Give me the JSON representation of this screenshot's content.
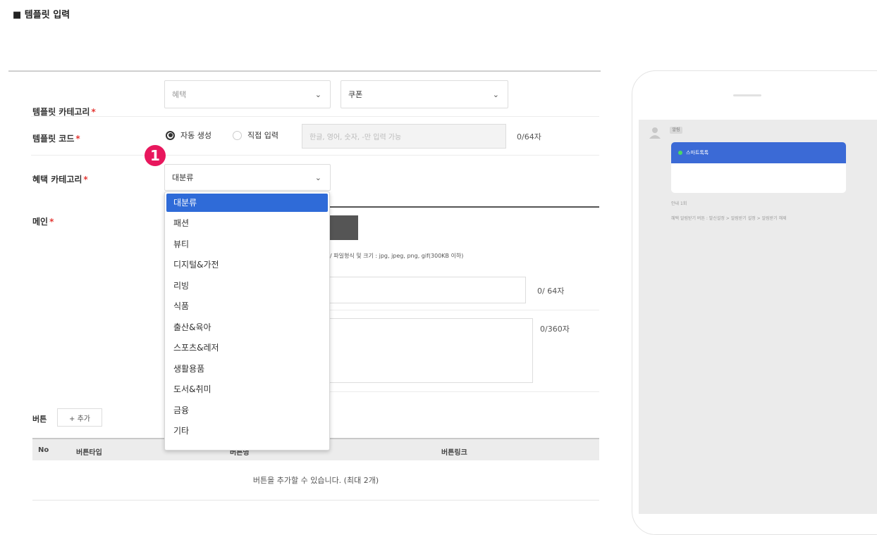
{
  "section_title": "■ 템플릿 입력",
  "form": {
    "category": {
      "label": "템플릿 카테고리",
      "select1": "혜택",
      "select2": "쿠폰"
    },
    "code": {
      "label": "템플릿 코드",
      "opt_auto": "자동 생성",
      "opt_manual": "직접 입력",
      "placeholder": "한글, 영어, 숫자, -만 입력 가능",
      "counter": "0/64자"
    },
    "benefit": {
      "label": "혜택 카테고리",
      "select": "대분류"
    },
    "image": {
      "label": "메인",
      "hint": "/ 파일형식 및 크기 : jpg, jpeg, png, gif(300KB 이하)"
    },
    "counter_title": "0/ 64자",
    "counter_body": "0/360자",
    "required_mark": "*"
  },
  "dropdown": {
    "items": [
      "대분류",
      "패션",
      "뷰티",
      "디지털&가전",
      "리빙",
      "식품",
      "출산&육아",
      "스포츠&레저",
      "생활용품",
      "도서&취미",
      "금융",
      "기타"
    ],
    "selected_index": 0
  },
  "step_badge": "1",
  "buttons_section": {
    "label": "버튼",
    "add_label": "+ 추가",
    "columns": [
      "No",
      "버튼타입",
      "버튼명",
      "버튼링크"
    ],
    "empty_text": "버튼을 추가할 수 있습니다. (최대 2개)"
  },
  "preview": {
    "sender": "알림",
    "bubble_title": "스마트톡톡",
    "line1": "안내 1회",
    "line2": "혜택 알림받기 버튼 : 발신설정 > 알림받기 설정 > 알림받기 해제"
  },
  "colors": {
    "accent": "#2f6bd8",
    "required": "#e53935",
    "badge": "#e8175d",
    "bubble": "#3b6ad6"
  }
}
